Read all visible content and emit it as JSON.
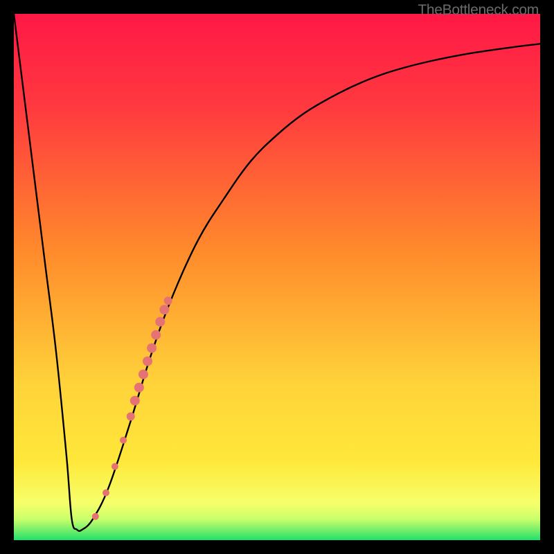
{
  "watermark": "TheBottleneck.com",
  "chart_data": {
    "type": "line",
    "title": "",
    "xlabel": "",
    "ylabel": "",
    "xlim": [
      0,
      100
    ],
    "ylim": [
      0,
      100
    ],
    "background_gradient": {
      "top": "#ff1846",
      "mid_high": "#ff8a2b",
      "mid": "#ffe83a",
      "mid_low": "#f6ff6b",
      "low": "#22e06a"
    },
    "series": [
      {
        "name": "bottleneck-curve",
        "color": "#000000",
        "x": [
          0,
          2,
          4,
          6,
          8,
          10,
          11,
          12,
          13,
          15,
          18,
          22,
          26,
          30,
          35,
          40,
          45,
          50,
          55,
          60,
          65,
          70,
          75,
          80,
          85,
          90,
          95,
          100
        ],
        "y": [
          100,
          84,
          68,
          52,
          36,
          16,
          4,
          2,
          2,
          4,
          10,
          22,
          35,
          46,
          57,
          65,
          72,
          77,
          81,
          84,
          86.5,
          88.5,
          90,
          91.2,
          92.2,
          93,
          93.7,
          94.3
        ]
      }
    ],
    "markers": {
      "name": "highlighted-points",
      "color": "#e57373",
      "points": [
        {
          "x": 15.5,
          "y": 4.5,
          "r": 5
        },
        {
          "x": 17.5,
          "y": 9,
          "r": 5
        },
        {
          "x": 19.2,
          "y": 14,
          "r": 5
        },
        {
          "x": 20.8,
          "y": 19,
          "r": 5
        },
        {
          "x": 22.2,
          "y": 23.5,
          "r": 6
        },
        {
          "x": 23.0,
          "y": 26.5,
          "r": 7
        },
        {
          "x": 23.8,
          "y": 29.0,
          "r": 7
        },
        {
          "x": 24.6,
          "y": 31.5,
          "r": 7
        },
        {
          "x": 25.4,
          "y": 34.0,
          "r": 7
        },
        {
          "x": 26.2,
          "y": 36.5,
          "r": 7
        },
        {
          "x": 27.0,
          "y": 39.0,
          "r": 7
        },
        {
          "x": 27.8,
          "y": 41.5,
          "r": 7
        },
        {
          "x": 28.6,
          "y": 43.8,
          "r": 7
        },
        {
          "x": 29.3,
          "y": 45.5,
          "r": 6
        }
      ]
    }
  }
}
